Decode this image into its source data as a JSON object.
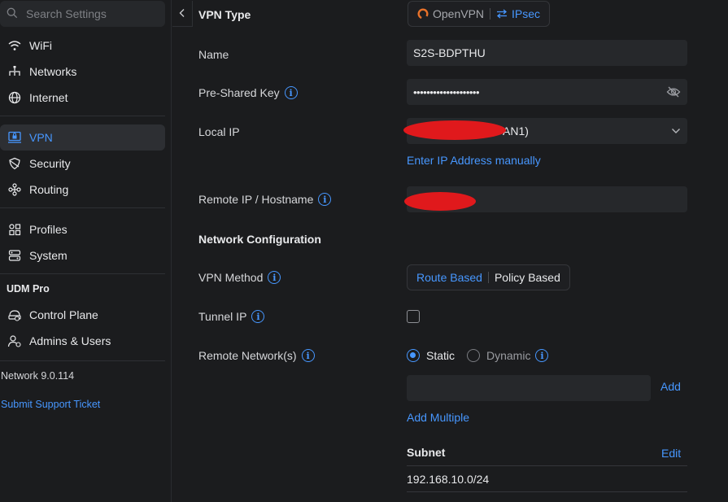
{
  "sidebar": {
    "search_placeholder": "Search Settings",
    "items": [
      {
        "label": "WiFi",
        "icon": "wifi-icon"
      },
      {
        "label": "Networks",
        "icon": "network-tree-icon"
      },
      {
        "label": "Internet",
        "icon": "globe-icon"
      },
      {
        "label": "VPN",
        "icon": "vpn-lock-icon",
        "active": true
      },
      {
        "label": "Security",
        "icon": "shield-icon"
      },
      {
        "label": "Routing",
        "icon": "routing-icon"
      },
      {
        "label": "Profiles",
        "icon": "profiles-grid-icon"
      },
      {
        "label": "System",
        "icon": "system-server-icon"
      }
    ],
    "device_section": "UDM Pro",
    "device_items": [
      {
        "label": "Control Plane",
        "icon": "control-plane-icon"
      },
      {
        "label": "Admins & Users",
        "icon": "admin-users-icon"
      }
    ],
    "version": "Network 9.0.114",
    "support_link": "Submit Support Ticket"
  },
  "form": {
    "vpn_type_label": "VPN Type",
    "vpn_type_options": [
      "OpenVPN",
      "IPsec"
    ],
    "vpn_type_selected": "IPsec",
    "name_label": "Name",
    "name_value": "S2S-BDPTHU",
    "psk_label": "Pre-Shared Key",
    "psk_value": "••••••••••••••••••••",
    "local_ip_label": "Local IP",
    "local_ip_value_visible": "AN1)",
    "enter_ip_manually": "Enter IP Address manually",
    "remote_ip_label": "Remote IP / Hostname",
    "network_config_heading": "Network Configuration",
    "vpn_method_label": "VPN Method",
    "vpn_method_options": [
      "Route Based",
      "Policy Based"
    ],
    "vpn_method_selected": "Route Based",
    "tunnel_ip_label": "Tunnel IP",
    "tunnel_ip_checked": false,
    "remote_networks_label": "Remote Network(s)",
    "remote_network_modes": [
      "Static",
      "Dynamic"
    ],
    "remote_network_mode_selected": "Static",
    "add_label": "Add",
    "add_multiple": "Add Multiple",
    "subnet_header": "Subnet",
    "edit_label": "Edit",
    "subnets": [
      "192.168.10.0/24"
    ]
  },
  "colors": {
    "accent": "#4797ff",
    "background": "#1b1c1e",
    "input_bg": "#26282b",
    "redaction": "#e0191c",
    "openvpn_icon": "#e8722a"
  }
}
